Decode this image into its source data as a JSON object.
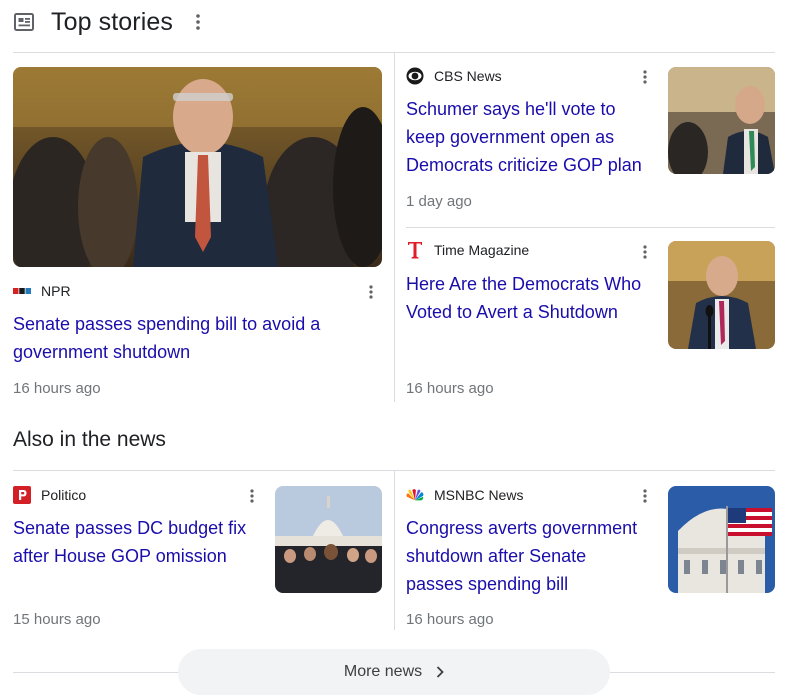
{
  "header": {
    "title": "Top stories",
    "icon": "newspaper-icon",
    "menu_icon": "more-vert-icon"
  },
  "top_stories": [
    {
      "source": "NPR",
      "logo": "npr-logo",
      "headline": "Senate passes spending bill to avoid a government shutdown",
      "headline_lines": [
        "Senate passes spending bill to avoid a",
        "government shutdown"
      ],
      "age": "16 hours ago"
    },
    {
      "source": "CBS News",
      "logo": "cbs-logo",
      "headline": "Schumer says he'll vote to keep government open as Democrats criticize GOP plan",
      "headline_lines": [
        "Schumer says he'll vote to",
        "keep government open as",
        "Democrats criticize GOP plan"
      ],
      "age": "1 day ago"
    },
    {
      "source": "Time Magazine",
      "logo": "time-logo",
      "headline": "Here Are the Democrats Who Voted to Avert a Shutdown",
      "headline_lines": [
        "Here Are the Democrats Who",
        "Voted to Avert a Shutdown"
      ],
      "age": "16 hours ago"
    }
  ],
  "also": {
    "title": "Also in the news",
    "items": [
      {
        "source": "Politico",
        "logo": "politico-logo",
        "headline": "Senate passes DC budget fix after House GOP omission",
        "headline_lines": [
          "Senate passes DC budget fix",
          "after House GOP omission"
        ],
        "age": "15 hours ago"
      },
      {
        "source": "MSNBC News",
        "logo": "msnbc-logo",
        "headline": "Congress averts government shutdown after Senate passes spending bill",
        "headline_lines": [
          "Congress averts government",
          "shutdown after Senate",
          "passes spending bill"
        ],
        "age": "16 hours ago"
      }
    ]
  },
  "more": {
    "label": "More news",
    "icon": "chevron-right-icon"
  },
  "colors": {
    "link": "#1a0dab",
    "meta": "#70757a",
    "divider": "#dadce0",
    "button_bg": "#f1f3f4"
  }
}
